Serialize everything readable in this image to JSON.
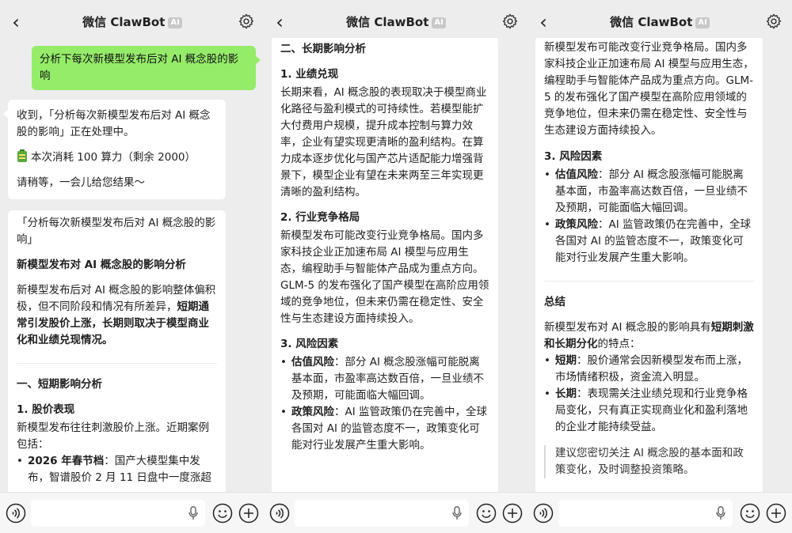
{
  "header": {
    "title": "微信 ClawBot",
    "badge": "AI",
    "back_icon": "‹"
  },
  "chat": {
    "user_message": "分析下每次新模型发布后对 AI 概念股的影响",
    "status": {
      "line1": "收到，「分析每次新模型发布后对 AI 概念股的影响」正在处理中。",
      "cost_icon": "battery-icon",
      "cost": "本次消耗 100 算力（剩余 2000）",
      "wait": "请稍等，一会儿给您结果～"
    },
    "report1": {
      "quote_title": "「分析每次新模型发布后对 AI 概念股的影响」",
      "heading": "新模型发布对 AI 概念股的影响分析",
      "intro_plain": "新模型发布后对 AI 概念股的影响整体偏积极，但不同阶段和情况有所差异，",
      "intro_bold": "短期通常引发股价上涨，长期则取决于模型商业化和业绩兑现情况。",
      "section1": "一、短期影响分析",
      "sub1": "1. 股价表现",
      "sub1_text": "新模型发布往往刺激股价上涨。近期案例包括：",
      "bullet1_bold": "2026 年春节档",
      "bullet1_text": "：国产大模型集中发布，智谱股价 2 月 11 日盘中一度涨超"
    },
    "report2": {
      "section2": "二、长期影响分析",
      "sub1": "1. 业绩兑现",
      "sub1_text": "长期来看，AI 概念股的表现取决于模型商业化路径与盈利模式的可持续性。若模型能扩大付费用户规模，提升成本控制与算力效率，企业有望实现更清晰的盈利结构。在算力成本逐步优化与国产芯片适配能力增强背景下，模型企业有望在未来两至三年实现更清晰的盈利结构。",
      "sub2": "2. 行业竞争格局",
      "sub2_text": "新模型发布可能改变行业竞争格局。国内多家科技企业正加速布局 AI 模型与应用生态，编程助手与智能体产品成为重点方向。GLM-5 的发布强化了国产模型在高阶应用领域的竞争地位，但未来仍需在稳定性、安全性与生态建设方面持续投入。",
      "sub3": "3. 风险因素",
      "risk1_bold": "估值风险",
      "risk1_text": "：部分 AI 概念股涨幅可能脱离基本面，市盈率高达数百倍，一旦业绩不及预期，可能面临大幅回调。",
      "risk2_bold": "政策风险",
      "risk2_text": "：AI 监管政策仍在完善中，全球各国对 AI 的监管态度不一，政策变化可能对行业发展产生重大影响。"
    },
    "report3": {
      "top_text": "新模型发布可能改变行业竞争格局。国内多家科技企业正加速布局 AI 模型与应用生态，编程助手与智能体产品成为重点方向。GLM-5 的发布强化了国产模型在高阶应用领域的竞争地位，但未来仍需在稳定性、安全性与生态建设方面持续投入。",
      "sub3": "3. 风险因素",
      "risk1_bold": "估值风险",
      "risk1_text": "：部分 AI 概念股涨幅可能脱离基本面，市盈率高达数百倍，一旦业绩不及预期，可能面临大幅回调。",
      "risk2_bold": "政策风险",
      "risk2_text": "：AI 监管政策仍在完善中，全球各国对 AI 的监管态度不一，政策变化可能对行业发展产生重大影响。",
      "summary": "总结",
      "summary_plain": "新模型发布对 AI 概念股的影响具有",
      "summary_bold": "短期刺激和长期分化",
      "summary_tail": "的特点：",
      "short_bold": "短期",
      "short_text": "：股价通常会因新模型发布而上涨，市场情绪积极，资金流入明显。",
      "long_bold": "长期",
      "long_text": "：表现需关注业绩兑现和行业竞争格局变化，只有真正实现商业化和盈利落地的企业才能持续受益。",
      "advice": "建议您密切关注 AI 概念股的基本面和政策变化，及时调整投资策略。"
    }
  },
  "colors": {
    "user_bubble": "#95ec69",
    "background": "#ededed",
    "bubble": "#ffffff"
  },
  "icons": [
    "back-icon",
    "gear-icon",
    "voice-icon",
    "mic-icon",
    "emoji-icon",
    "plus-icon",
    "battery-icon"
  ]
}
